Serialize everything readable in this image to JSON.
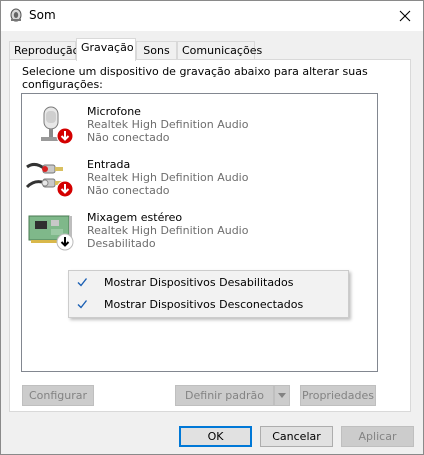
{
  "window": {
    "title": "Som"
  },
  "tabs": [
    {
      "label": "Reprodução"
    },
    {
      "label": "Gravação"
    },
    {
      "label": "Sons"
    },
    {
      "label": "Comunicações"
    }
  ],
  "instructions": "Selecione um dispositivo de gravação abaixo para alterar suas configurações:",
  "devices": [
    {
      "name": "Microfone",
      "driver": "Realtek High Definition Audio",
      "status": "Não conectado",
      "icon": "microphone-icon",
      "badge": "red-down-arrow"
    },
    {
      "name": "Entrada",
      "driver": "Realtek High Definition Audio",
      "status": "Não conectado",
      "icon": "line-in-cable-icon",
      "badge": "red-down-arrow"
    },
    {
      "name": "Mixagem estéreo",
      "driver": "Realtek High Definition Audio",
      "status": "Desabilitado",
      "icon": "sound-card-icon",
      "badge": "black-down-arrow"
    }
  ],
  "context_menu": {
    "items": [
      {
        "label": "Mostrar Dispositivos Desabilitados",
        "checked": true
      },
      {
        "label": "Mostrar Dispositivos Desconectados",
        "checked": true
      }
    ]
  },
  "panel_buttons": {
    "configure": "Configurar",
    "set_default": "Definir padrão",
    "properties": "Propriedades"
  },
  "dialog_buttons": {
    "ok": "OK",
    "cancel": "Cancelar",
    "apply": "Aplicar"
  },
  "colors": {
    "accent": "#0078d7",
    "status_red": "#d40000",
    "window_bg": "#f0f0f0"
  }
}
